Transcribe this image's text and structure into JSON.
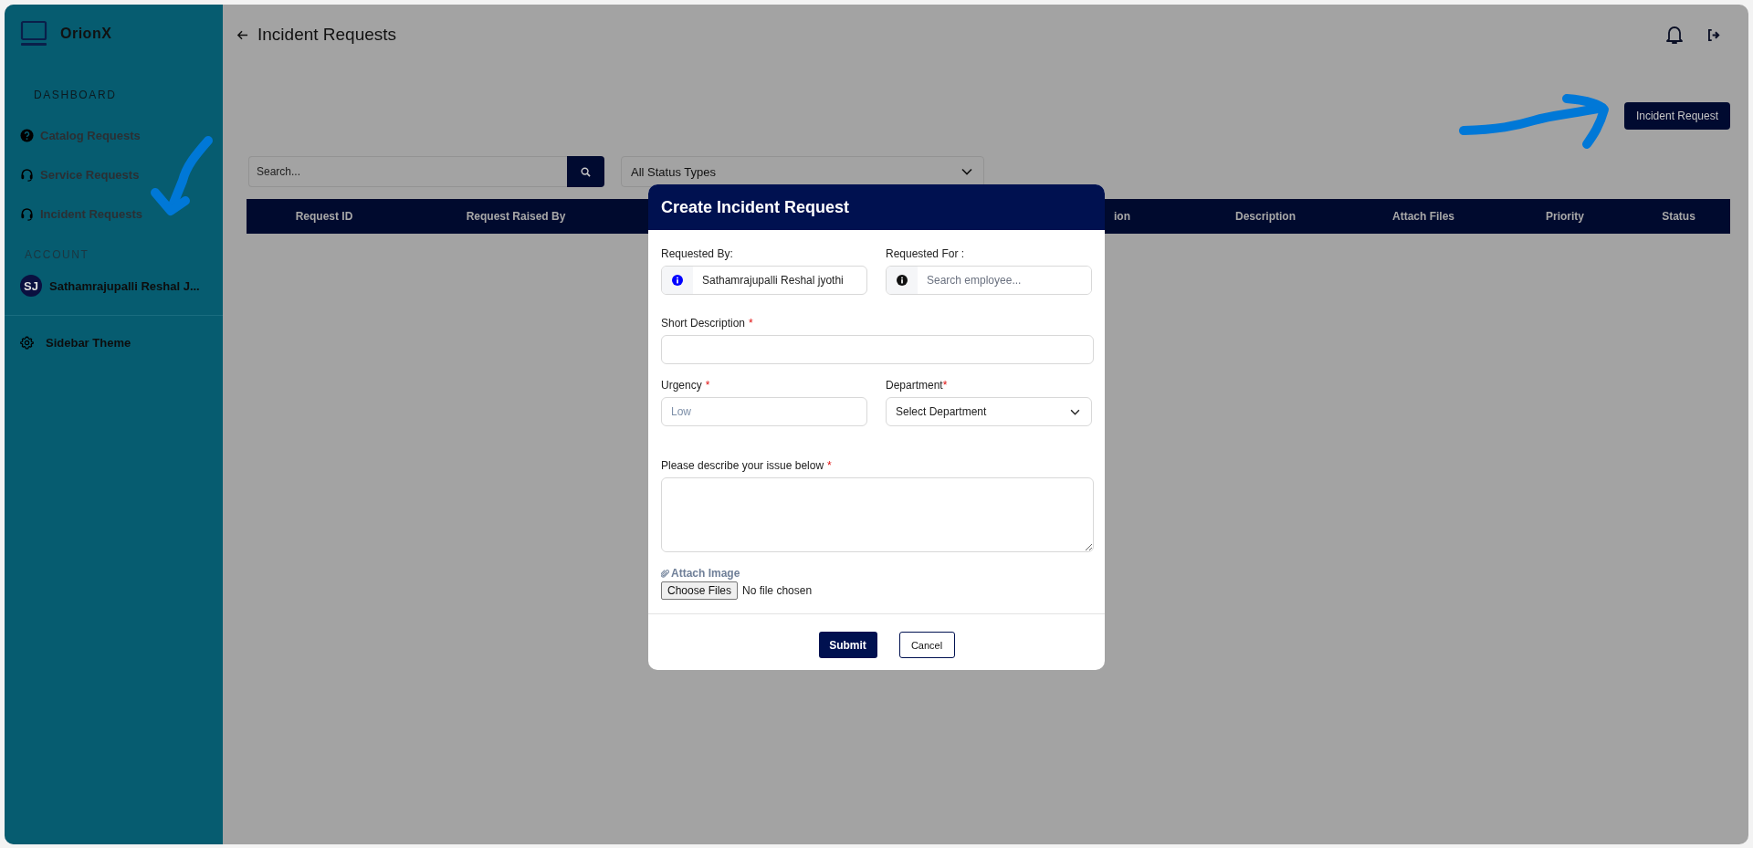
{
  "sidebar": {
    "brand": "OrionX",
    "sections": [
      {
        "title": "DASHBOARD",
        "items": [
          {
            "label": "Catalog Requests",
            "kind": "help"
          },
          {
            "label": "Service Requests",
            "kind": "support"
          },
          {
            "label": "Incident Requests",
            "kind": "support"
          }
        ]
      }
    ],
    "account": {
      "title": "ACCOUNT",
      "initials": "SJ",
      "name": "Sathamrajupalli Reshal J..."
    },
    "theme": "Sidebar Theme"
  },
  "header": {
    "title": "Incident Requests"
  },
  "new_button": "Incident Request",
  "search": {
    "placeholder": "Search..."
  },
  "status_filter": {
    "value": "All Status Types"
  },
  "table": {
    "columns": [
      "Request ID",
      "Request Raised By",
      "ion",
      "Description",
      "Attach Files",
      "Priority",
      "Status"
    ]
  },
  "modal": {
    "title": "Create Incident Request",
    "requested_by": {
      "label": "Requested By:",
      "value": "Sathamrajupalli Reshal jyothi"
    },
    "requested_for": {
      "label": "Requested For :",
      "placeholder": "Search employee..."
    },
    "short_description": {
      "label": "Short Description",
      "mark": "*"
    },
    "urgency": {
      "label": "Urgency",
      "mark": "*",
      "placeholder": "Low"
    },
    "department": {
      "label": "Department",
      "mark": "*",
      "value": "Select Department"
    },
    "description": {
      "label": "Please describe your issue below",
      "mark": "*"
    },
    "attach": {
      "label": "Attach Image",
      "button": "Choose Files",
      "status": "No file chosen"
    },
    "buttons": {
      "submit": "Submit",
      "cancel": "Cancel"
    }
  }
}
